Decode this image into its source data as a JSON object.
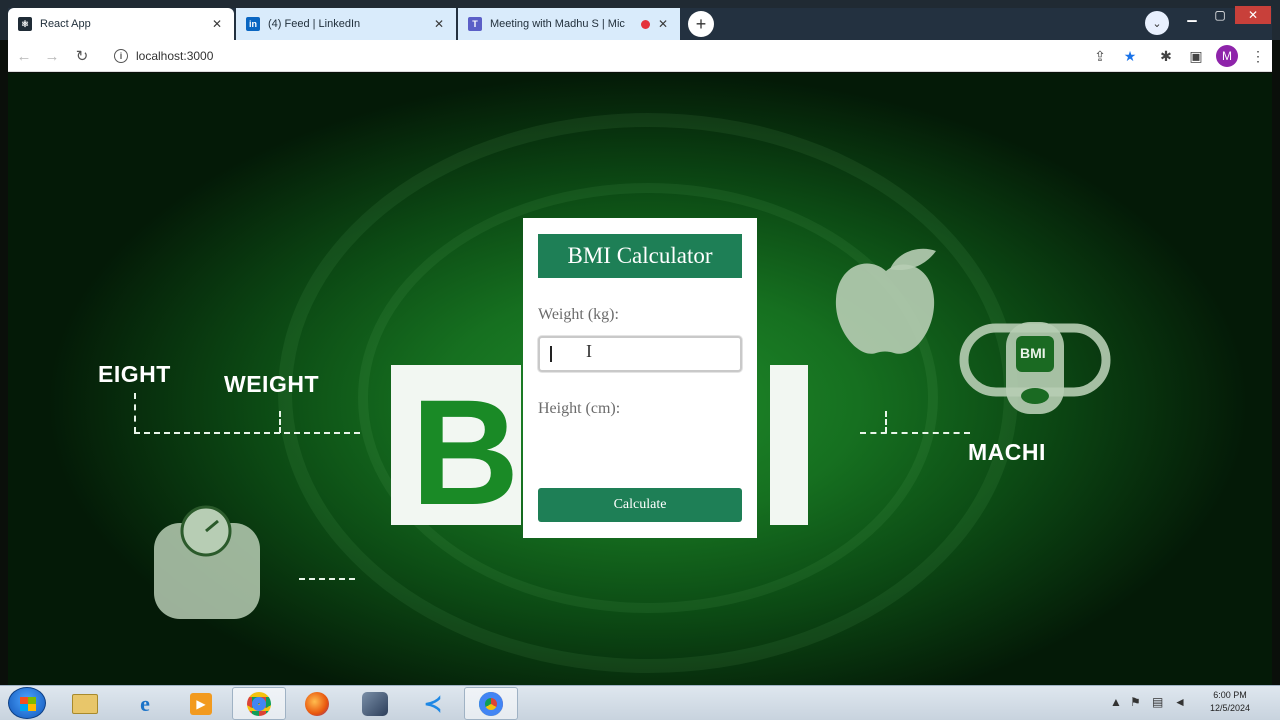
{
  "browser": {
    "tabs": [
      {
        "title": "React App",
        "favicon": "react-icon",
        "active": true
      },
      {
        "title": "(4) Feed | LinkedIn",
        "favicon": "linkedin-icon",
        "active": false
      },
      {
        "title": "Meeting with Madhu S | Mic",
        "favicon": "teams-icon",
        "active": false,
        "recording": true
      }
    ],
    "new_tab_glyph": "+",
    "address": "localhost:3000"
  },
  "background": {
    "left_words": [
      "EIGHT",
      "WEIGHT"
    ],
    "right_word": "MACHI",
    "badge_text": "BMI"
  },
  "card": {
    "title": "BMI Calculator",
    "weight_label": "Weight (kg):",
    "weight_value": "",
    "height_label": "Height (cm):",
    "height_value": "",
    "button_label": "Calculate"
  },
  "taskbar": {
    "clock_time": "6:00 PM",
    "clock_date": "12/5/2024"
  },
  "colors": {
    "card_accent": "#1e7f56",
    "page_green": "#1a8a26",
    "tab_strip": "#233140"
  }
}
